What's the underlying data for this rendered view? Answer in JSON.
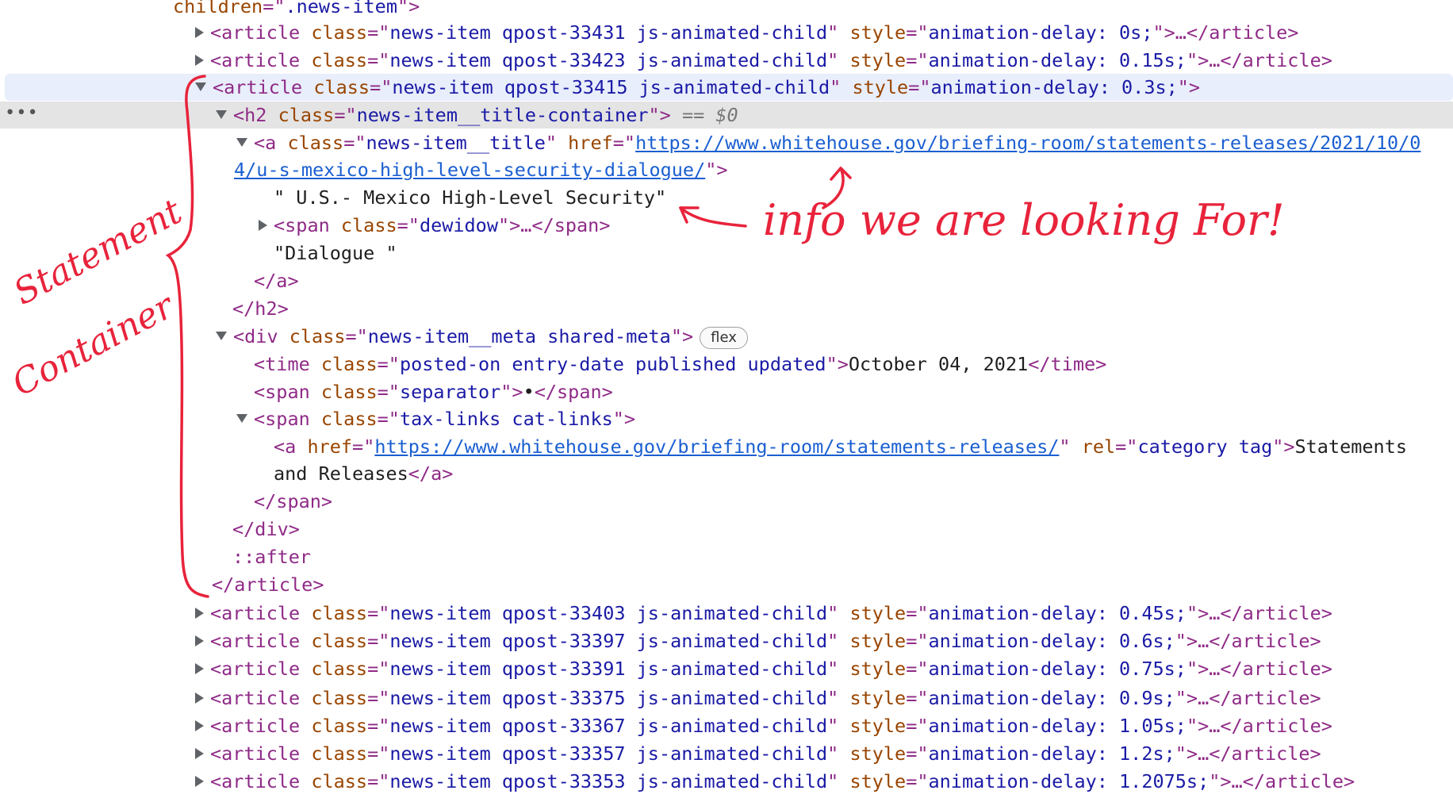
{
  "header_line": {
    "attr_name": "children",
    "attr_value": ".news-item"
  },
  "collapsed_before": [
    {
      "qpost": "news-item qpost-33431 js-animated-child",
      "style": "animation-delay: 0s;"
    },
    {
      "qpost": "news-item qpost-33423 js-animated-child",
      "style": "animation-delay: 0.15s;"
    }
  ],
  "expanded_article": {
    "class": "news-item qpost-33415 js-animated-child",
    "style": "animation-delay: 0.3s;"
  },
  "h2": {
    "class": "news-item__title-container",
    "marker": "== $0"
  },
  "title_link": {
    "class": "news-item__title",
    "href_part1": "https://www.whitehouse.gov/briefing-room/statements-releases/2021/10/0",
    "href_part2": "4/u-s-mexico-high-level-security-dialogue/",
    "text1": "\" U.S.- Mexico High-Level Security\"",
    "span_class": "dewidow",
    "text2": "\"Dialogue \""
  },
  "meta_div": {
    "class": "news-item__meta shared-meta",
    "badge": "flex"
  },
  "time": {
    "class": "posted-on entry-date published updated",
    "text": "October 04, 2021"
  },
  "separator": {
    "class": "separator",
    "text": "•"
  },
  "tax_span": {
    "class": "tax-links cat-links"
  },
  "cat_link": {
    "href": "https://www.whitehouse.gov/briefing-room/statements-releases/",
    "rel": "category tag",
    "text1": "Statements",
    "text2": "and Releases"
  },
  "pseudo": "::after",
  "collapsed_after": [
    {
      "qpost": "news-item qpost-33403 js-animated-child",
      "style": "animation-delay: 0.45s;"
    },
    {
      "qpost": "news-item qpost-33397 js-animated-child",
      "style": "animation-delay: 0.6s;"
    },
    {
      "qpost": "news-item qpost-33391 js-animated-child",
      "style": "animation-delay: 0.75s;"
    },
    {
      "qpost": "news-item qpost-33375 js-animated-child",
      "style": "animation-delay: 0.9s;"
    },
    {
      "qpost": "news-item qpost-33367 js-animated-child",
      "style": "animation-delay: 1.05s;"
    },
    {
      "qpost": "news-item qpost-33357 js-animated-child",
      "style": "animation-delay: 1.2s;"
    },
    {
      "qpost": "news-item qpost-33353 js-animated-child",
      "style": "animation-delay: 1.2075s;"
    }
  ],
  "annotations": {
    "arrow_note": "info we are looking For!",
    "bracket_line1": "Statement",
    "bracket_line2": "Container"
  },
  "colors": {
    "annotation": "#e8233b",
    "selected_row": "#e4e4e4",
    "hover_row": "#e8eefb",
    "link": "#1a5fd1"
  }
}
